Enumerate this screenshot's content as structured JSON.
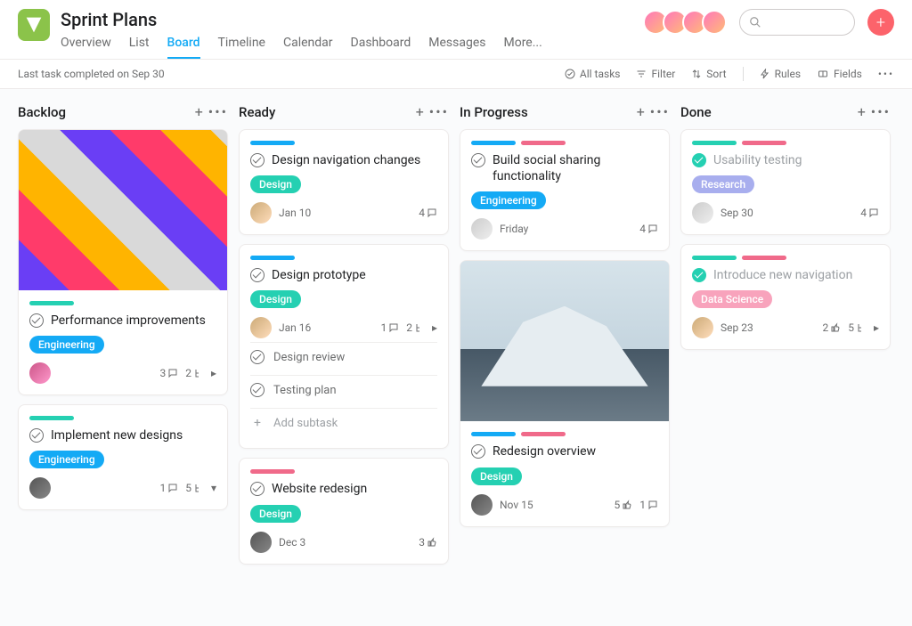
{
  "project": {
    "title": "Sprint Plans"
  },
  "tabs": {
    "overview": "Overview",
    "list": "List",
    "board": "Board",
    "timeline": "Timeline",
    "calendar": "Calendar",
    "dashboard": "Dashboard",
    "messages": "Messages",
    "more": "More..."
  },
  "status_note": "Last task completed on Sep 30",
  "tools": {
    "alltasks": "All tasks",
    "filter": "Filter",
    "sort": "Sort",
    "rules": "Rules",
    "fields": "Fields"
  },
  "columns": {
    "backlog": "Backlog",
    "ready": "Ready",
    "inprogress": "In Progress",
    "done": "Done"
  },
  "tags": {
    "engineering": "Engineering",
    "design": "Design",
    "research": "Research",
    "datascience": "Data Science"
  },
  "cards": {
    "perf": {
      "title": "Performance improvements",
      "comments": "3",
      "sub": "2"
    },
    "impl": {
      "title": "Implement new designs",
      "comments": "1",
      "sub": "5"
    },
    "nav": {
      "title": "Design navigation changes",
      "date": "Jan 10",
      "comments": "4"
    },
    "proto": {
      "title": "Design prototype",
      "date": "Jan 16",
      "comments": "1",
      "sub": "2",
      "sub1": "Design review",
      "sub2": "Testing plan",
      "addsub": "Add subtask"
    },
    "web": {
      "title": "Website redesign",
      "date": "Dec 3",
      "likes": "3"
    },
    "social": {
      "title": "Build social sharing functionality",
      "date": "Friday",
      "comments": "4"
    },
    "redesign": {
      "title": "Redesign overview",
      "date": "Nov 15",
      "likes": "5",
      "comments": "1"
    },
    "usab": {
      "title": "Usability testing",
      "date": "Sep 30",
      "comments": "4"
    },
    "intro": {
      "title": "Introduce new navigation",
      "date": "Sep 23",
      "likes": "2",
      "sub": "5"
    }
  }
}
